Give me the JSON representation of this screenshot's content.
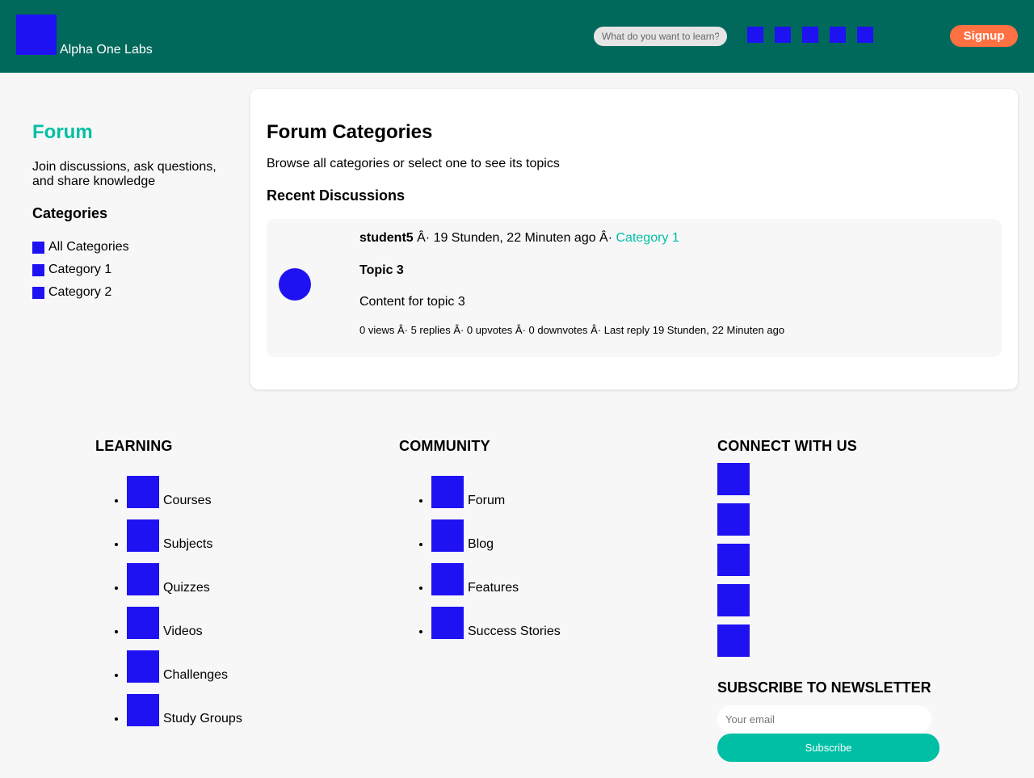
{
  "colors": {
    "header_bg": "#00695c",
    "accent": "#00bfa5",
    "signup_bg": "#ff7043",
    "placeholder_icon": "#1f12f2"
  },
  "header": {
    "site_name": "Alpha One Labs",
    "search_placeholder": "What do you want to learn?",
    "icons": [
      "nav-icon-1",
      "nav-icon-2",
      "nav-icon-3",
      "nav-icon-4",
      "nav-icon-5"
    ],
    "signup_label": "Signup"
  },
  "sidebar": {
    "title": "Forum",
    "description": "Join discussions, ask questions, and share knowledge",
    "categories_heading": "Categories",
    "categories": [
      {
        "label": "All Categories"
      },
      {
        "label": "Category 1"
      },
      {
        "label": "Category 2"
      }
    ]
  },
  "main": {
    "title": "Forum Categories",
    "subtitle": "Browse all categories or select one to see its topics",
    "recent_heading": "Recent Discussions",
    "discussions": [
      {
        "author": "student5",
        "sep1": " Â· 19 Stunden, 22 Minuten ago Â· ",
        "category": "Category 1",
        "title": "Topic 3",
        "content": "Content for topic 3",
        "stats": "0 views Â· 5 replies Â· 0 upvotes Â· 0 downvotes Â· Last reply 19 Stunden, 22 Minuten ago"
      }
    ]
  },
  "footer": {
    "learning": {
      "heading": "LEARNING",
      "items": [
        "Courses",
        "Subjects",
        "Quizzes",
        "Videos",
        "Challenges",
        "Study Groups"
      ]
    },
    "community": {
      "heading": "COMMUNITY",
      "items": [
        "Forum",
        "Blog",
        "Features",
        "Success Stories"
      ]
    },
    "connect": {
      "heading": "CONNECT WITH US",
      "icons": [
        "social-icon-1",
        "social-icon-2",
        "social-icon-3",
        "social-icon-4",
        "social-icon-5"
      ]
    },
    "newsletter": {
      "heading": "SUBSCRIBE TO NEWSLETTER",
      "placeholder": "Your email",
      "button_label": "Subscribe"
    }
  }
}
